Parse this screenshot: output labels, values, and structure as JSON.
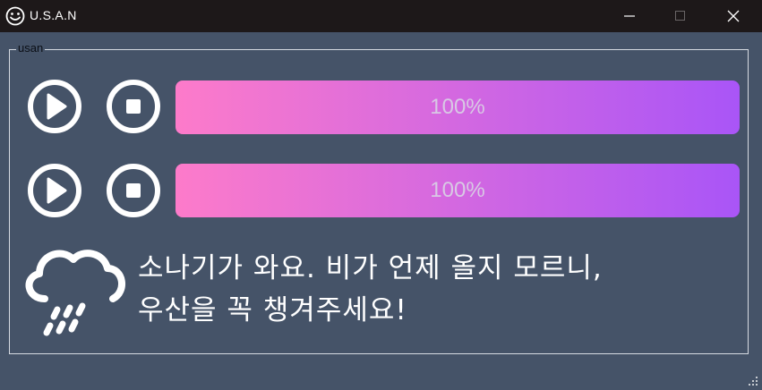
{
  "window": {
    "title": "U.S.A.N",
    "app_icon": "smiley-face-icon",
    "controls": [
      "minimize-icon",
      "maximize-icon",
      "close-icon"
    ]
  },
  "group": {
    "title": "usan"
  },
  "players": [
    {
      "play_icon": "play-icon",
      "stop_icon": "stop-icon",
      "progress": 1.0,
      "progress_text": "100%"
    },
    {
      "play_icon": "play-icon",
      "stop_icon": "stop-icon",
      "progress": 1.0,
      "progress_text": "100%"
    }
  ],
  "colors": {
    "background": "#455368",
    "titlebar": "#1d1819",
    "progress_start": "#fd7bca",
    "progress_end": "#a955f7"
  },
  "weather": {
    "icon": "rain-cloud-icon",
    "message_line1": "소나기가 와요. 비가 언제 올지 모르니,",
    "message_line2": "우산을 꼭 챙겨주세요!"
  }
}
